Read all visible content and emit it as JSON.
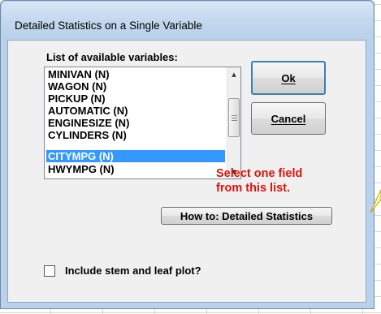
{
  "dialog": {
    "title": "Detailed Statistics on a Single Variable",
    "list_label": "List of available variables:",
    "variables": [
      "MINIVAN (N)",
      "WAGON (N)",
      "PICKUP (N)",
      "AUTOMATIC (N)",
      "ENGINESIZE (N)",
      "CYLINDERS (N)",
      "CITYMPG (N)",
      "HWYMPG (N)"
    ],
    "selected_variable": "CITYMPG (N)",
    "ok_label": "Ok",
    "cancel_label": "Cancel",
    "hint": "Select one field\nfrom this list.",
    "howto_label": "How to: Detailed Statistics",
    "checkbox_label": "Include stem and leaf plot?",
    "checkbox_checked": false
  },
  "colors": {
    "selection": "#3399ff",
    "hint_text": "#e0110b",
    "callout": "#fff7b3"
  },
  "icons": {
    "scroll_up": "triangle-up",
    "scroll_down": "triangle-down"
  }
}
